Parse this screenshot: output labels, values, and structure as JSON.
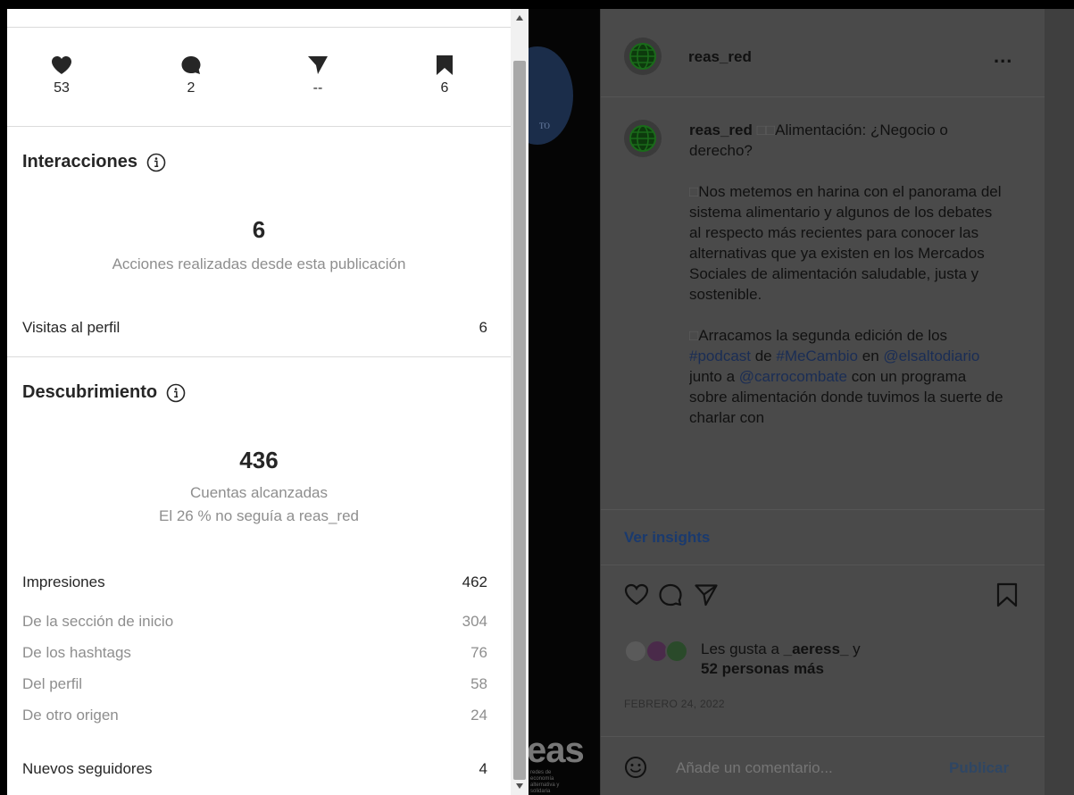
{
  "stats": {
    "likes": "53",
    "comments": "2",
    "shares": "--",
    "saves": "6"
  },
  "interactions": {
    "title": "Interacciones",
    "total": "6",
    "subtitle": "Acciones realizadas desde esta publicación",
    "rows": [
      {
        "label": "Visitas al perfil",
        "value": "6"
      }
    ]
  },
  "discovery": {
    "title": "Descubrimiento",
    "total": "436",
    "subtitle": "Cuentas alcanzadas",
    "subtitle2": "El 26 % no seguía a reas_red",
    "impressions_label": "Impresiones",
    "impressions_value": "462",
    "breakdown": [
      {
        "label": "De la sección de inicio",
        "value": "304"
      },
      {
        "label": "De los hashtags",
        "value": "76"
      },
      {
        "label": "Del perfil",
        "value": "58"
      },
      {
        "label": "De otro origen",
        "value": "24"
      }
    ],
    "followers_label": "Nuevos seguidores",
    "followers_value": "4"
  },
  "image": {
    "brand_text": "eas",
    "brand_small": "redes de economía alternativa y solidaria",
    "badge_text": "TO"
  },
  "post": {
    "username": "reas_red",
    "more": "...",
    "caption_user": "reas_red",
    "caption_p1": "Alimentación: ¿Negocio o derecho?",
    "caption_p2": "Nos metemos en harina con el panorama del sistema alimentario y algunos de los debates al respecto más recientes para conocer las alternativas que ya existen en los Mercados Sociales de alimentación saludable, justa y sostenible.",
    "caption_p3_a": "Arracamos la segunda edición de los ",
    "caption_p3_tag1": "#podcast",
    "caption_p3_b": " de ",
    "caption_p3_tag2": "#MeCambio",
    "caption_p3_c": " en ",
    "caption_p3_mention1": "@elsaltodiario",
    "caption_p3_d": " junto a ",
    "caption_p3_mention2": "@carrocombate",
    "caption_p3_e": " con un programa sobre alimentación donde tuvimos la suerte de charlar con",
    "insights_link": "Ver insights",
    "likes_prefix": "Les gusta a ",
    "likes_user": "_aeress_",
    "likes_mid": " y",
    "likes_others": "52 personas más",
    "date": "FEBRERO 24, 2022",
    "comment_placeholder": "Añade un comentario...",
    "publish_label": "Publicar"
  }
}
